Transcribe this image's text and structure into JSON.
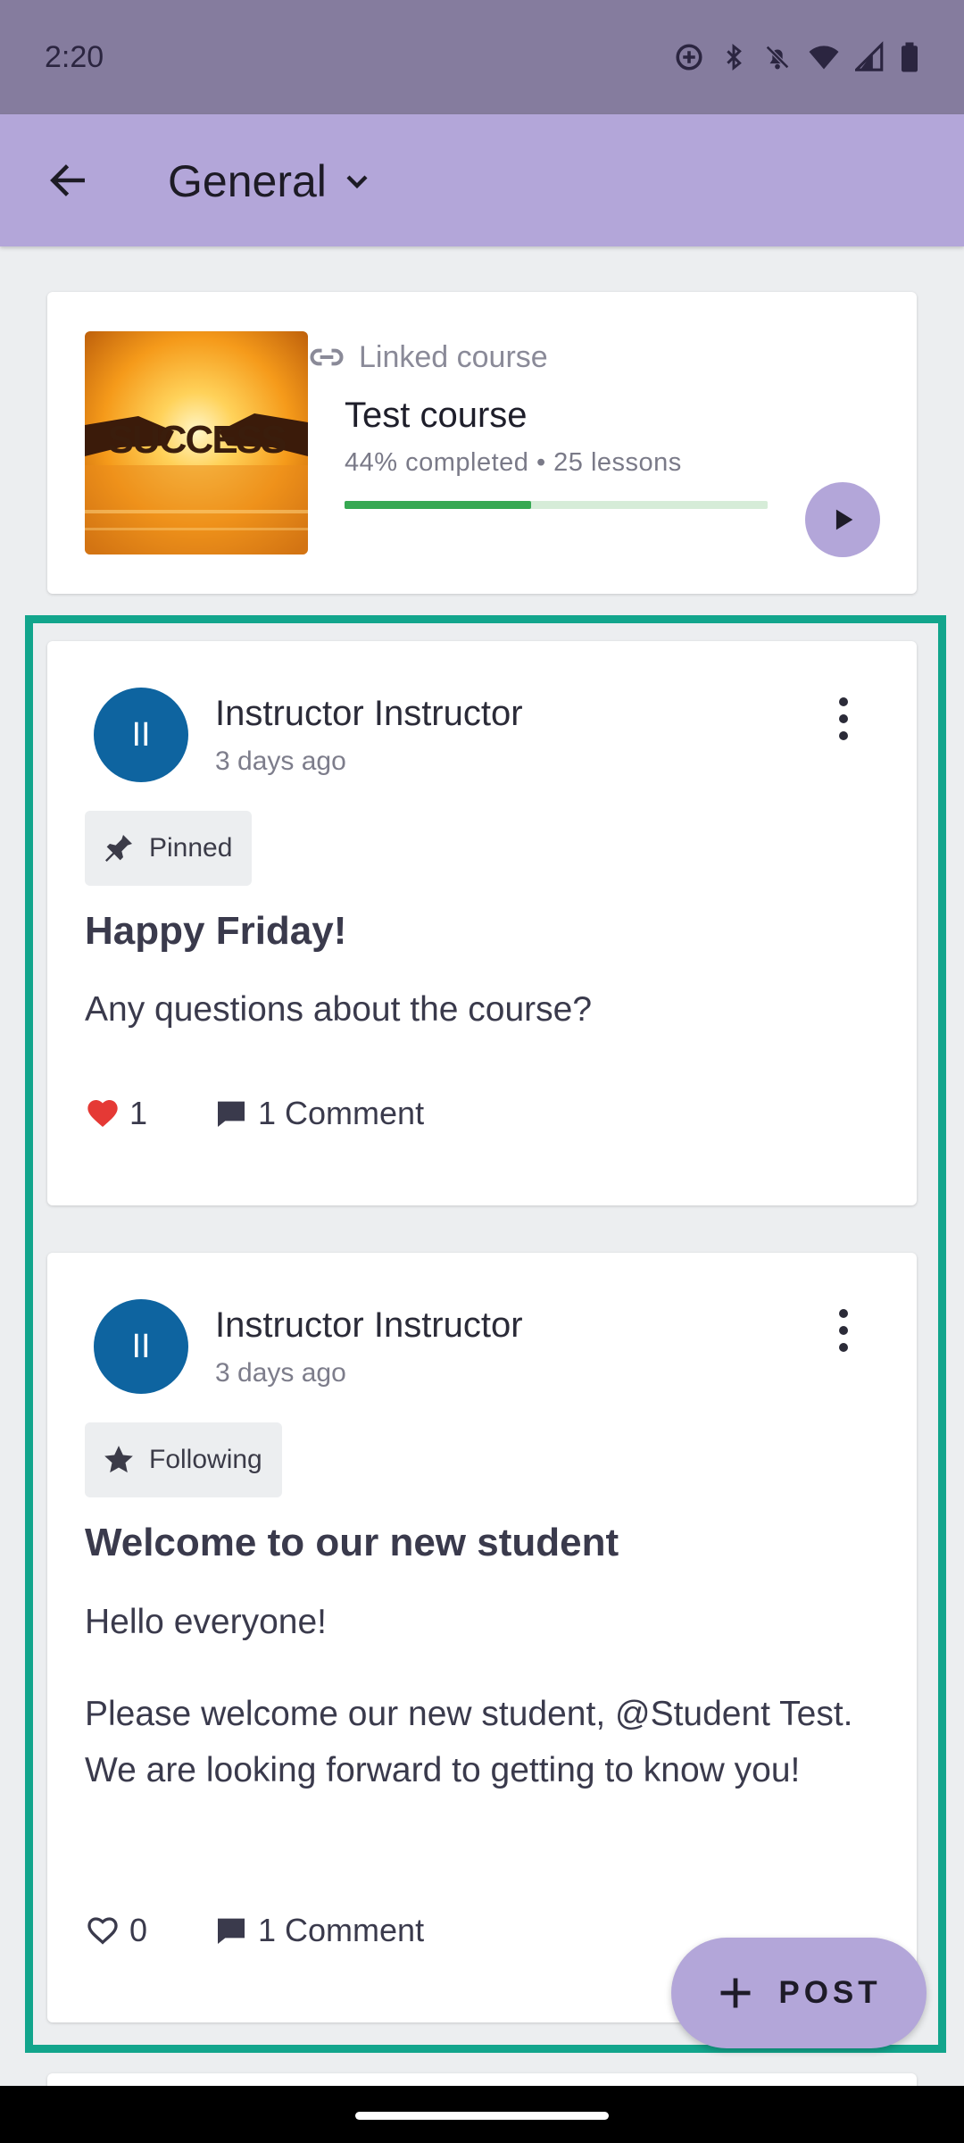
{
  "status_bar": {
    "time": "2:20"
  },
  "app_bar": {
    "title": "General"
  },
  "linked_course": {
    "label": "Linked course",
    "thumbnail_text": "SUCCESS",
    "title": "Test course",
    "meta": "44% completed • 25 lessons",
    "progress_fraction": 0.44,
    "colors": {
      "progress": "#36a852",
      "track": "#d6ecd8",
      "play_button": "#b3a6d9"
    }
  },
  "posts": [
    {
      "avatar_initials": "II",
      "author": "Instructor Instructor",
      "time_ago": "3 days ago",
      "badge": {
        "icon": "pin-icon",
        "label": "Pinned"
      },
      "title": "Happy Friday!",
      "paragraphs": [
        "Any questions about the course?"
      ],
      "likes": "1",
      "liked": true,
      "comments": "1 Comment"
    },
    {
      "avatar_initials": "II",
      "author": "Instructor Instructor",
      "time_ago": "3 days ago",
      "badge": {
        "icon": "star-icon",
        "label": "Following"
      },
      "title": "Welcome to our new student",
      "paragraphs": [
        "Hello everyone!",
        "Please welcome our new student, @Student Test. We are looking forward to getting to know you!"
      ],
      "likes": "0",
      "liked": false,
      "comments": "1 Comment"
    }
  ],
  "fab": {
    "label": "POST"
  },
  "colors": {
    "app_bar": "#b3a6d9",
    "status_bar": "#857c9e",
    "highlight": "#12a58c",
    "avatar": "#0e64a0",
    "like": "#e53935"
  }
}
